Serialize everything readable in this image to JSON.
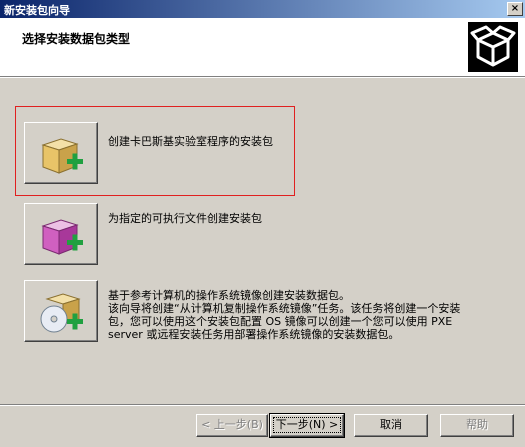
{
  "window": {
    "title": "新安装包向导",
    "close_glyph": "×"
  },
  "header": {
    "title": "选择安装数据包类型",
    "icon": "package-box-icon"
  },
  "options": [
    {
      "label": "创建卡巴斯基实验室程序的安装包",
      "icon": "box-plus-icon",
      "color": "#e8c468"
    },
    {
      "label": "为指定的可执行文件创建安装包",
      "icon": "box-plus-icon",
      "color": "#d060c0"
    },
    {
      "label": "基于参考计算机的操作系统镜像创建安装数据包。",
      "icon": "disc-box-plus-icon",
      "color": "#e8c468"
    }
  ],
  "description": {
    "line1": "该向导将创建“从计算机复制操作系统镜像”任务。该任务将创建一个安装",
    "line2": "包，您可以使用这个安装包配置 OS 镜像可以创建一个您可以使用 PXE",
    "line3": "server 或远程安装任务用部署操作系统镜像的安装数据包。"
  },
  "buttons": {
    "back": "< 上一步(B)",
    "next": "下一步(N) >",
    "cancel": "取消",
    "help": "帮助"
  },
  "colors": {
    "title_start": "#0a246a",
    "title_end": "#a6caf0",
    "plus": "#20a040",
    "focus_border": "#e02020"
  }
}
